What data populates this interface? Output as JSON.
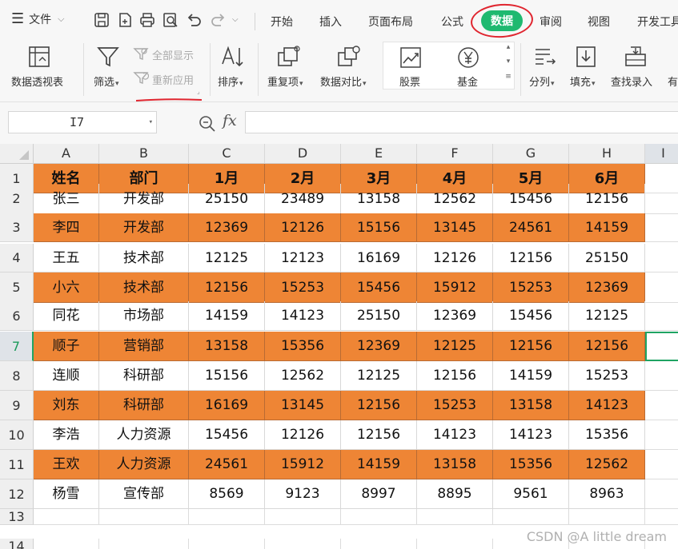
{
  "menu": {
    "file_label": "文件",
    "tabs": [
      {
        "label": "开始",
        "active": false
      },
      {
        "label": "插入",
        "active": false
      },
      {
        "label": "页面布局",
        "active": false
      },
      {
        "label": "公式",
        "active": false
      },
      {
        "label": "数据",
        "active": true
      },
      {
        "label": "审阅",
        "active": false
      },
      {
        "label": "视图",
        "active": false
      },
      {
        "label": "开发工具",
        "active": false
      }
    ],
    "quick_access_icons": [
      "save-icon",
      "export-pdf-icon",
      "print-icon",
      "print-preview-icon",
      "undo-icon",
      "redo-icon",
      "more-dropdown-icon"
    ],
    "active_tab_color": "#1fb970",
    "annotation_color": "#e0252f"
  },
  "ribbon": {
    "pivot_label": "数据透视表",
    "filter_label": "筛选",
    "show_all_label": "全部显示",
    "reapply_label": "重新应用",
    "sort_label": "排序",
    "duplicates_label": "重复项",
    "compare_label": "数据对比",
    "stocks_label": "股票",
    "funds_label": "基金",
    "split_label": "分列",
    "fill_label": "填充",
    "lookup_label": "查找录入",
    "more_label": "有"
  },
  "formula_bar": {
    "cell_ref": "I7",
    "fx_label": "fx",
    "formula": ""
  },
  "grid": {
    "columns": [
      "A",
      "B",
      "C",
      "D",
      "E",
      "F",
      "G",
      "H",
      "I"
    ],
    "selected_column": "I",
    "selected_row": 7,
    "row_numbers": [
      1,
      2,
      3,
      4,
      5,
      6,
      7,
      8,
      9,
      10,
      11,
      12,
      13,
      14
    ],
    "highlight_color": "#ee8535",
    "header": [
      "姓名",
      "部门",
      "1月",
      "2月",
      "3月",
      "4月",
      "5月",
      "6月"
    ],
    "rows": [
      [
        "张三",
        "开发部",
        "25150",
        "23489",
        "13158",
        "12562",
        "15456",
        "12156"
      ],
      [
        "李四",
        "开发部",
        "12369",
        "12126",
        "15156",
        "13145",
        "24561",
        "14159"
      ],
      [
        "王五",
        "技术部",
        "12125",
        "12123",
        "16169",
        "12126",
        "12156",
        "25150"
      ],
      [
        "小六",
        "技术部",
        "12156",
        "15253",
        "15456",
        "15912",
        "15253",
        "12369"
      ],
      [
        "同花",
        "市场部",
        "14159",
        "14123",
        "25150",
        "12369",
        "15456",
        "12125"
      ],
      [
        "顺子",
        "营销部",
        "13158",
        "15356",
        "12369",
        "12125",
        "12156",
        "12156"
      ],
      [
        "连顺",
        "科研部",
        "15156",
        "12562",
        "12125",
        "12156",
        "14159",
        "15253"
      ],
      [
        "刘东",
        "科研部",
        "16169",
        "13145",
        "12156",
        "15253",
        "13158",
        "14123"
      ],
      [
        "李浩",
        "人力资源",
        "15456",
        "12126",
        "12156",
        "14123",
        "14123",
        "15356"
      ],
      [
        "王欢",
        "人力资源",
        "24561",
        "15912",
        "14159",
        "13158",
        "15356",
        "12562"
      ],
      [
        "杨雪",
        "宣传部",
        "8569",
        "9123",
        "8997",
        "8895",
        "9561",
        "8963"
      ]
    ]
  },
  "watermark": "CSDN @A little dream"
}
